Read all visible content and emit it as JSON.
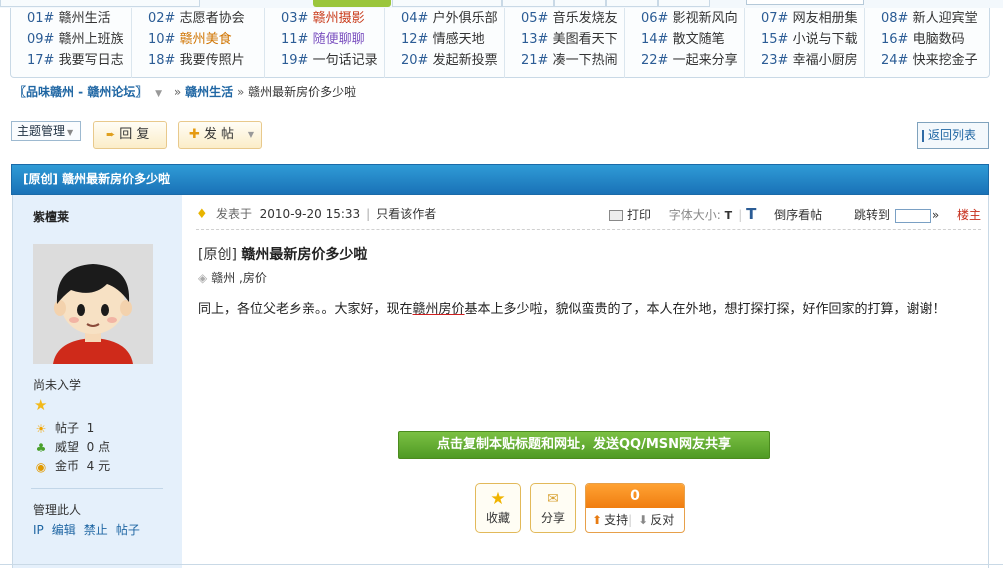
{
  "board_grid": {
    "columns": [
      [
        {
          "num": "01#",
          "label": "赣州生活",
          "style": ""
        },
        {
          "num": "09#",
          "label": "赣州上班族",
          "style": ""
        },
        {
          "num": "17#",
          "label": "我要写日志",
          "style": ""
        }
      ],
      [
        {
          "num": "02#",
          "label": "志愿者协会",
          "style": ""
        },
        {
          "num": "10#",
          "label": "赣州美食",
          "style": "or"
        },
        {
          "num": "18#",
          "label": "我要传照片",
          "style": ""
        }
      ],
      [
        {
          "num": "03#",
          "label": "赣州摄影",
          "style": "hl"
        },
        {
          "num": "11#",
          "label": "随便聊聊",
          "style": "pu"
        },
        {
          "num": "19#",
          "label": "一句话记录",
          "style": ""
        }
      ],
      [
        {
          "num": "04#",
          "label": "户外俱乐部",
          "style": ""
        },
        {
          "num": "12#",
          "label": "情感天地",
          "style": ""
        },
        {
          "num": "20#",
          "label": "发起新投票",
          "style": ""
        }
      ],
      [
        {
          "num": "05#",
          "label": "音乐发烧友",
          "style": ""
        },
        {
          "num": "13#",
          "label": "美图看天下",
          "style": ""
        },
        {
          "num": "21#",
          "label": "凑一下热闹",
          "style": ""
        }
      ],
      [
        {
          "num": "06#",
          "label": "影视新风向",
          "style": ""
        },
        {
          "num": "14#",
          "label": "散文随笔",
          "style": ""
        },
        {
          "num": "22#",
          "label": "一起来分享",
          "style": ""
        }
      ],
      [
        {
          "num": "07#",
          "label": "网友相册集",
          "style": ""
        },
        {
          "num": "15#",
          "label": "小说与下载",
          "style": ""
        },
        {
          "num": "23#",
          "label": "幸福小厨房",
          "style": ""
        }
      ],
      [
        {
          "num": "08#",
          "label": "新人迎宾堂",
          "style": ""
        },
        {
          "num": "16#",
          "label": "电脑数码",
          "style": ""
        },
        {
          "num": "24#",
          "label": "快来挖金子",
          "style": ""
        }
      ]
    ]
  },
  "breadcrumb": {
    "forum": "〖品味赣州 - 赣州论坛〗",
    "sep": "»",
    "section": "赣州生活",
    "current": "赣州最新房价多少啦"
  },
  "toolbar": {
    "manage": "主题管理",
    "reply": "回 复",
    "post": "发 帖",
    "back": "返回列表"
  },
  "thread": {
    "title_bar": "[原创] 赣州最新房价多少啦"
  },
  "author": {
    "name": "紫檀莱",
    "rank": "尚未入学",
    "posts_label": "帖子",
    "posts": "1",
    "prestige_label": "威望",
    "prestige": "0 点",
    "money_label": "金币",
    "money": "4 元",
    "manage_label": "管理此人",
    "manage_links": [
      "IP",
      "编辑",
      "禁止",
      "帖子"
    ]
  },
  "meta": {
    "posted_prefix": "发表于",
    "posted_at": "2010-9-20 15:33",
    "only_author": "只看该作者",
    "print": "打印",
    "font_size": "字体大小:",
    "reverse": "倒序看帖",
    "jump": "跳转到",
    "jump_arrow": "»",
    "floor": "楼主"
  },
  "post": {
    "prefix": "[原创]",
    "title": "赣州最新房价多少啦",
    "tags": "赣州 ,房价",
    "body_before": "同上，各位父老乡亲。。大家好，现在",
    "body_kw": "赣州房价",
    "body_after": "基本上多少啦，貌似蛮贵的了，本人在外地，想打探打探，好作回家的打算，谢谢！"
  },
  "share": {
    "copy_share": "点击复制本贴标题和网址，发送QQ/MSN网友共享",
    "favorite": "收藏",
    "share": "分享",
    "support": "支持",
    "oppose": "反对",
    "vote_count": "0"
  }
}
